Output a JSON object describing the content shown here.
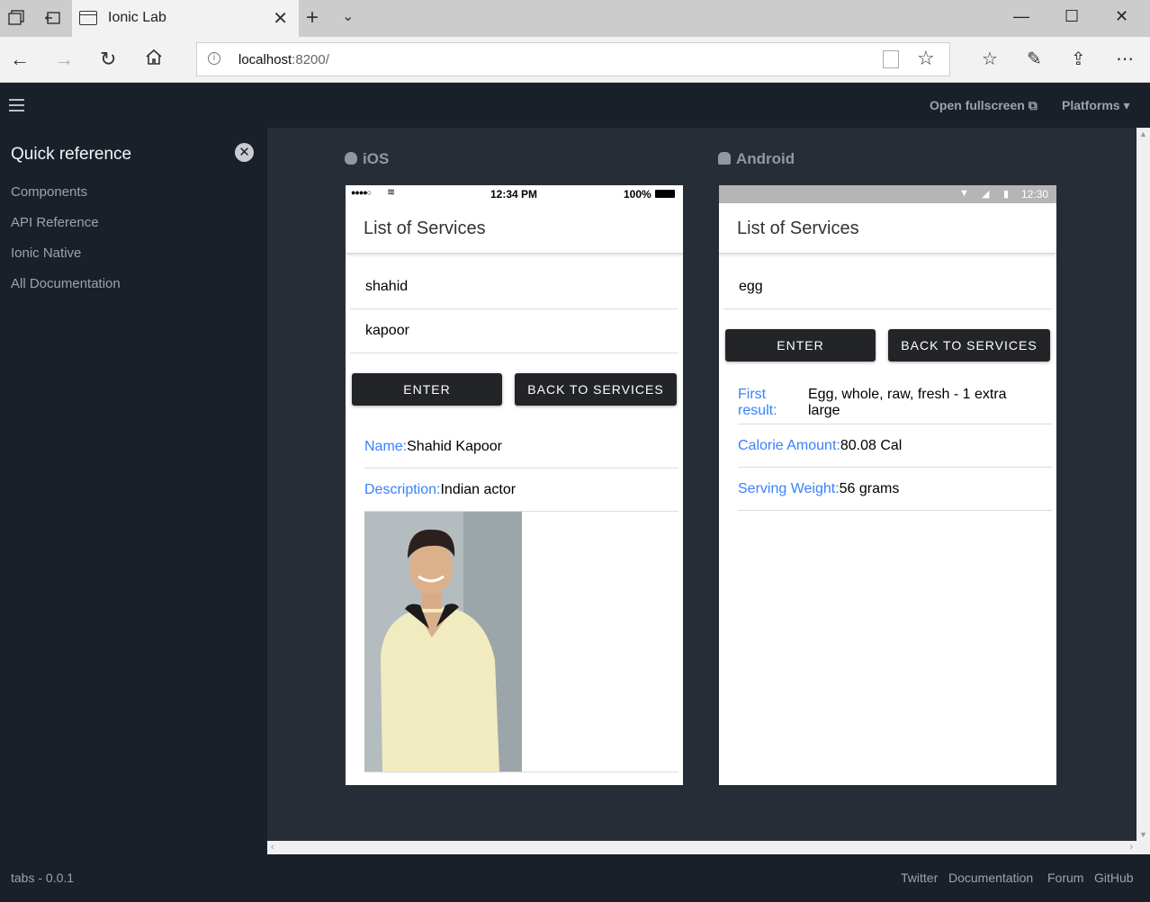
{
  "browser": {
    "tab_title": "Ionic Lab",
    "url_host": "localhost",
    "url_rest": ":8200/"
  },
  "lab": {
    "open_fullscreen": "Open fullscreen",
    "platforms": "Platforms",
    "version": "tabs - 0.0.1"
  },
  "sidebar": {
    "title": "Quick reference",
    "items": [
      "Components",
      "API Reference",
      "Ionic Native",
      "All Documentation"
    ]
  },
  "ios": {
    "label": "iOS",
    "status_time": "12:34 PM",
    "status_battery": "100%",
    "title": "List of Services",
    "input1": "shahid",
    "input2": "kapoor",
    "enter_label": "ENTER",
    "back_label": "BACK TO SERVICES",
    "name_key": "Name:",
    "name_val": "Shahid Kapoor",
    "desc_key": "Description:",
    "desc_val": "Indian actor"
  },
  "android": {
    "label": "Android",
    "status_time": "12:30",
    "title": "List of Services",
    "input1": "egg",
    "enter_label": "ENTER",
    "back_label": "BACK TO SERVICES",
    "first_key": "First result:",
    "first_val": "Egg, whole, raw, fresh - 1 extra large",
    "cal_key": "Calorie Amount:",
    "cal_val": "80.08 Cal",
    "weight_key": "Serving Weight:",
    "weight_val": "56 grams"
  },
  "footer_links": [
    "Twitter",
    "Documentation",
    "Forum",
    "GitHub"
  ]
}
